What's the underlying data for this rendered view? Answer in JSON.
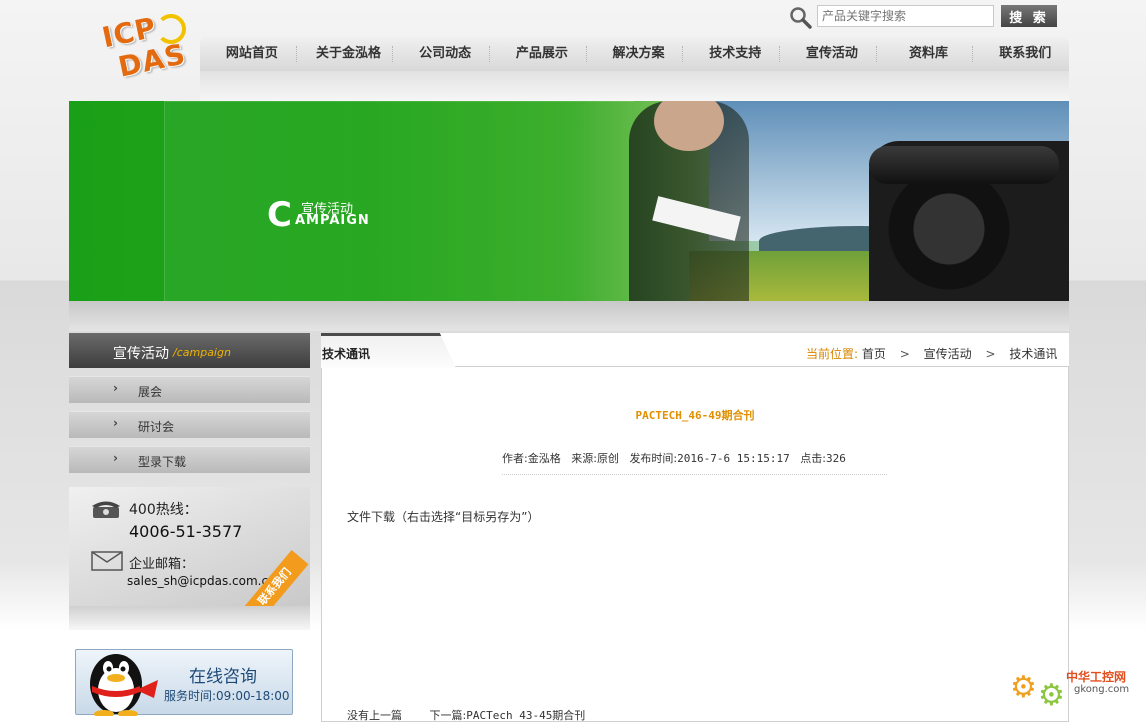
{
  "logo": {
    "line1": "ICP",
    "line2": "DAS"
  },
  "search": {
    "placeholder": "产品关键字搜索",
    "button_label": "搜 索"
  },
  "nav": {
    "items": [
      "网站首页",
      "关于金泓格",
      "公司动态",
      "产品展示",
      "解决方案",
      "技术支持",
      "宣传活动",
      "资料库",
      "联系我们"
    ]
  },
  "banner": {
    "letter": "C",
    "title_cn": "宣传活动",
    "title_en": "AMPAIGN"
  },
  "sidebar": {
    "header_cn": "宣传活动",
    "header_en": "/campaign",
    "items": [
      {
        "label": "展会"
      },
      {
        "label": "研讨会"
      },
      {
        "label": "型录下载"
      }
    ],
    "chevron": "›"
  },
  "contact": {
    "hotline_label": "400热线：",
    "hotline_number": "4006-51-3577",
    "email_label": "企业邮箱：",
    "email": "sales_sh@icpdas.com.cn",
    "ribbon": "联系我们"
  },
  "qq": {
    "title": "在线咨询",
    "hours": "服务时间:09:00-18:00"
  },
  "main": {
    "tab_label": "技术通讯",
    "breadcrumb": {
      "here_label": "当前位置:",
      "items": [
        "首页",
        "宣传活动",
        "技术通讯"
      ],
      "separator": ">"
    },
    "article": {
      "title": "PACTECH_46-49期合刊",
      "author_label": "作者:",
      "author": "金泓格",
      "source_label": "来源:",
      "source": "原创",
      "date_label": "发布时间:",
      "date": "2016-7-6 15:15:17",
      "clicks_label": "点击:",
      "clicks": "326",
      "download_text": "文件下载（右击选择“目标另存为”）",
      "prev": "没有上一篇",
      "next_label": "下一篇:",
      "next": "PACTech 43-45期合刊"
    }
  },
  "watermark": {
    "site_cn": "中华工控网",
    "site_en": "gkong.com"
  },
  "colors": {
    "accent": "#e09000",
    "nav_bg": "#e4e4e4",
    "banner_green": "#22a51c"
  }
}
